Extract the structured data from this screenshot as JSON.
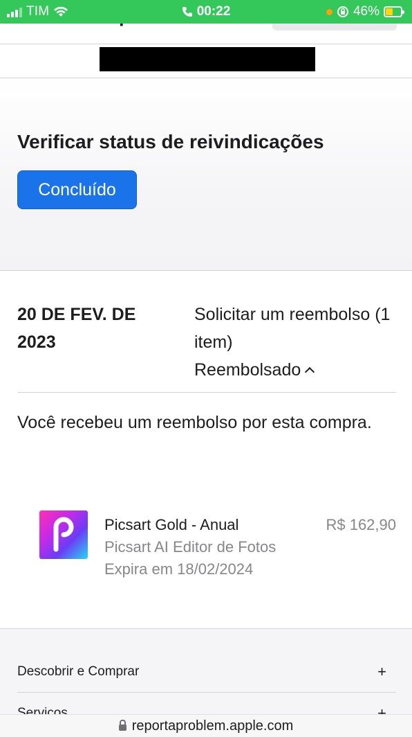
{
  "status_bar": {
    "carrier": "TIM",
    "time": "00:22",
    "battery_percent": "46%",
    "battery_level": 0.46
  },
  "header": {
    "title": "Relatar um problema"
  },
  "status_section": {
    "title": "Verificar status de reivindicações",
    "done_button": "Concluído"
  },
  "claim": {
    "date": "20 DE FEV. DE 2023",
    "request": "Solicitar um reembolso (1 item)",
    "status": "Reembolsado",
    "message": "Você recebeu um reembolso por esta compra."
  },
  "item": {
    "name": "Picsart Gold - Anual",
    "developer": "Picsart AI Editor de Fotos",
    "expiry": "Expira em 18/02/2024",
    "price": "R$ 162,90",
    "icon": "picsart-app-icon"
  },
  "footer": {
    "rows": [
      {
        "label": "Descobrir e Comprar",
        "icon": "+"
      },
      {
        "label": "Serviços",
        "icon": "+"
      }
    ]
  },
  "url_bar": {
    "domain": "reportaproblem.apple.com"
  },
  "colors": {
    "status_bar": "#34c759",
    "button": "#1a73e8",
    "secondary_text": "#86868b"
  }
}
